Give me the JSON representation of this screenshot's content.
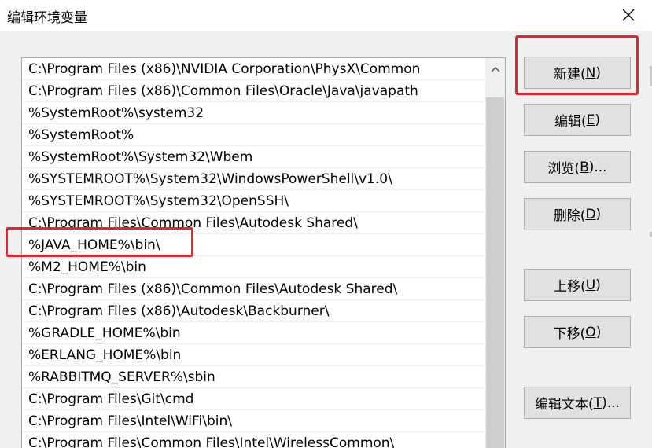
{
  "window": {
    "title": "编辑环境变量",
    "close_icon": "close-icon"
  },
  "path_entries": [
    "C:\\Program Files (x86)\\NVIDIA Corporation\\PhysX\\Common",
    "C:\\Program Files (x86)\\Common Files\\Oracle\\Java\\javapath",
    "%SystemRoot%\\system32",
    "%SystemRoot%",
    "%SystemRoot%\\System32\\Wbem",
    "%SYSTEMROOT%\\System32\\WindowsPowerShell\\v1.0\\",
    "%SYSTEMROOT%\\System32\\OpenSSH\\",
    "C:\\Program Files\\Common Files\\Autodesk Shared\\",
    "%JAVA_HOME%\\bin\\",
    "%M2_HOME%\\bin",
    "C:\\Program Files (x86)\\Common Files\\Autodesk Shared\\",
    "C:\\Program Files (x86)\\Autodesk\\Backburner\\",
    "%GRADLE_HOME%\\bin",
    "%ERLANG_HOME%\\bin",
    "%RABBITMQ_SERVER%\\sbin",
    "C:\\Program Files\\Git\\cmd",
    "C:\\Program Files\\Intel\\WiFi\\bin\\",
    "C:\\Program Files\\Common Files\\Intel\\WirelessCommon\\"
  ],
  "buttons": {
    "new": {
      "label": "新建(",
      "key": "N",
      "tail": ")"
    },
    "edit": {
      "label": "编辑(",
      "key": "E",
      "tail": ")"
    },
    "browse": {
      "label": "浏览(",
      "key": "B",
      "tail": ")..."
    },
    "delete": {
      "label": "删除(",
      "key": "D",
      "tail": ")"
    },
    "move_up": {
      "label": "上移(",
      "key": "U",
      "tail": ")"
    },
    "move_down": {
      "label": "下移(",
      "key": "O",
      "tail": ")"
    },
    "edit_text": {
      "label": "编辑文本(",
      "key": "T",
      "tail": ")..."
    }
  },
  "colors": {
    "annotation_red": "#e8232b",
    "button_face": "#e1e1e1",
    "dialog_background": "#f0f0f0"
  }
}
